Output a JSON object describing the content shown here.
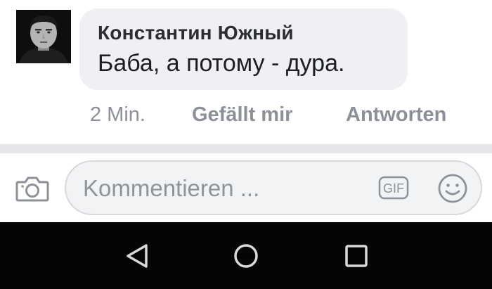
{
  "comment": {
    "author": "Константин Южный",
    "text": "Баба, а потому - дура.",
    "time": "2 Min.",
    "like_label": "Gefällt mir",
    "reply_label": "Antworten"
  },
  "composer": {
    "placeholder": "Kommentieren ...",
    "gif_label": "GIF",
    "camera_icon": "camera-icon",
    "emoji_icon": "smiley-icon"
  },
  "navbar": {
    "back_icon": "back-triangle-icon",
    "home_icon": "home-circle-icon",
    "recent_icon": "recent-apps-square-icon"
  },
  "colors": {
    "bubble": "#eef0f3",
    "meta_text": "#8c9099",
    "divider": "#e4e6e9",
    "navbar": "#050505"
  }
}
